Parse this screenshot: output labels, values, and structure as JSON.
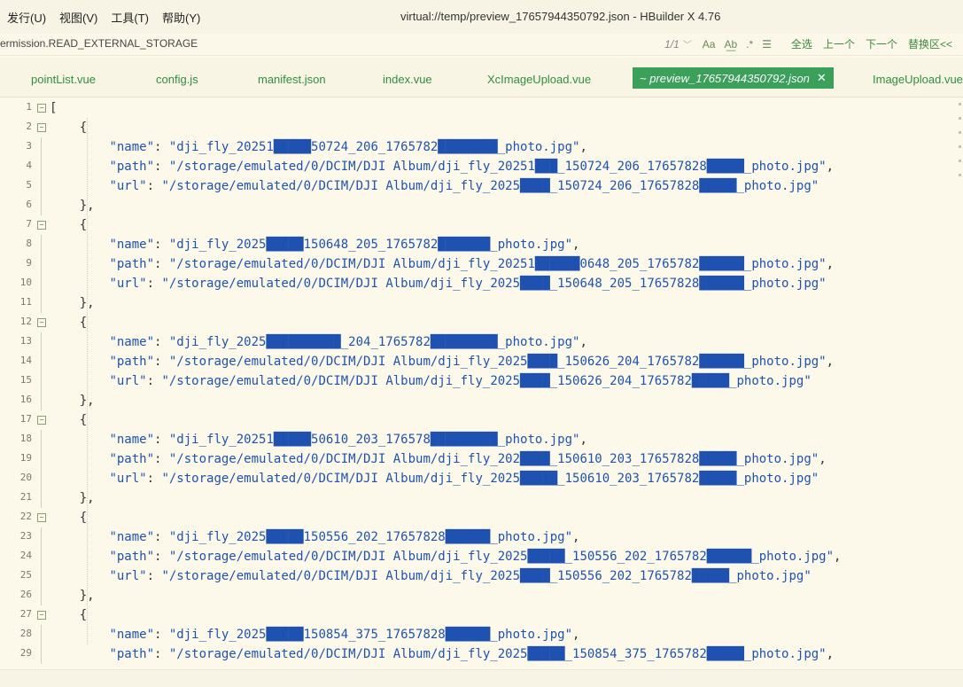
{
  "menu": [
    "发行(U)",
    "视图(V)",
    "工具(T)",
    "帮助(Y)"
  ],
  "window_title": "virtual://temp/preview_17657944350792.json - HBuilder X 4.76",
  "breadcrumb": "ermission.READ_EXTERNAL_STORAGE",
  "find": {
    "match_count": "1/1",
    "chevron": "﹀",
    "opt_case": "Aa",
    "opt_word": "A͟b",
    "opt_regex": ".*",
    "opt_lines": "☰",
    "select_all": "全选",
    "prev": "上一个",
    "next": "下一个",
    "replace": "替换区<<"
  },
  "tabs": [
    {
      "label": "pointList.vue"
    },
    {
      "label": "config.js"
    },
    {
      "label": "manifest.json"
    },
    {
      "label": "index.vue"
    },
    {
      "label": "XcImageUpload.vue"
    },
    {
      "label": "~ preview_17657944350792.json",
      "active": true,
      "close": "✕"
    },
    {
      "label": "ImageUpload.vue"
    }
  ],
  "editor": {
    "lines": [
      {
        "n": "1",
        "t": "["
      },
      {
        "n": "2",
        "t": "    {"
      },
      {
        "n": "3",
        "t": "        \"name\": \"dji_fly_20251█████50724_206_1765782████████_photo.jpg\","
      },
      {
        "n": "4",
        "t": "        \"path\": \"/storage/emulated/0/DCIM/DJI Album/dji_fly_20251███_150724_206_17657828█████_photo.jpg\","
      },
      {
        "n": "5",
        "t": "        \"url\": \"/storage/emulated/0/DCIM/DJI Album/dji_fly_2025████_150724_206_17657828█████_photo.jpg\""
      },
      {
        "n": "6",
        "t": "    },"
      },
      {
        "n": "7",
        "t": "    {"
      },
      {
        "n": "8",
        "t": "        \"name\": \"dji_fly_2025█████150648_205_1765782███████_photo.jpg\","
      },
      {
        "n": "9",
        "t": "        \"path\": \"/storage/emulated/0/DCIM/DJI Album/dji_fly_20251██████0648_205_1765782██████_photo.jpg\","
      },
      {
        "n": "10",
        "t": "        \"url\": \"/storage/emulated/0/DCIM/DJI Album/dji_fly_2025████_150648_205_17657828██████_photo.jpg\""
      },
      {
        "n": "11",
        "t": "    },"
      },
      {
        "n": "12",
        "t": "    {"
      },
      {
        "n": "13",
        "t": "        \"name\": \"dji_fly_2025██████████_204_1765782█████████_photo.jpg\","
      },
      {
        "n": "14",
        "t": "        \"path\": \"/storage/emulated/0/DCIM/DJI Album/dji_fly_2025████_150626_204_1765782██████_photo.jpg\","
      },
      {
        "n": "15",
        "t": "        \"url\": \"/storage/emulated/0/DCIM/DJI Album/dji_fly_2025████_150626_204_1765782█████_photo.jpg\""
      },
      {
        "n": "16",
        "t": "    },"
      },
      {
        "n": "17",
        "t": "    {"
      },
      {
        "n": "18",
        "t": "        \"name\": \"dji_fly_20251█████50610_203_176578█████████_photo.jpg\","
      },
      {
        "n": "19",
        "t": "        \"path\": \"/storage/emulated/0/DCIM/DJI Album/dji_fly_202████_150610_203_17657828█████_photo.jpg\","
      },
      {
        "n": "20",
        "t": "        \"url\": \"/storage/emulated/0/DCIM/DJI Album/dji_fly_2025█████_150610_203_1765782█████_photo.jpg\""
      },
      {
        "n": "21",
        "t": "    },"
      },
      {
        "n": "22",
        "t": "    {"
      },
      {
        "n": "23",
        "t": "        \"name\": \"dji_fly_2025█████150556_202_17657828██████_photo.jpg\","
      },
      {
        "n": "24",
        "t": "        \"path\": \"/storage/emulated/0/DCIM/DJI Album/dji_fly_2025█████_150556_202_1765782██████_photo.jpg\","
      },
      {
        "n": "25",
        "t": "        \"url\": \"/storage/emulated/0/DCIM/DJI Album/dji_fly_2025████_150556_202_1765782█████_photo.jpg\""
      },
      {
        "n": "26",
        "t": "    },"
      },
      {
        "n": "27",
        "t": "    {"
      },
      {
        "n": "28",
        "t": "        \"name\": \"dji_fly_2025█████150854_375_17657828██████_photo.jpg\","
      },
      {
        "n": "29",
        "t": "        \"path\": \"/storage/emulated/0/DCIM/DJI Album/dji_fly_2025█████_150854_375_1765782█████_photo.jpg\","
      }
    ]
  }
}
